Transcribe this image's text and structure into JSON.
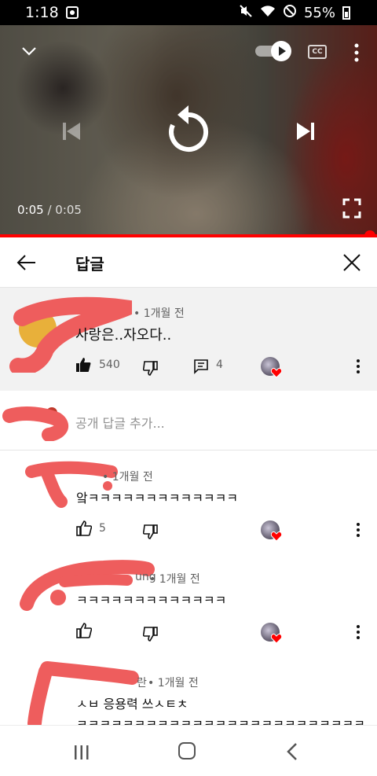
{
  "status_bar": {
    "time": "1:18",
    "battery": "55%"
  },
  "video": {
    "current_time": "0:05",
    "separator": " / ",
    "duration": "0:05",
    "cc_label": "CC"
  },
  "header": {
    "title": "답글"
  },
  "original_comment": {
    "age": "• 1개월 전",
    "text": "사랑은..자오다..",
    "likes": "540",
    "replies": "4"
  },
  "add_reply": {
    "placeholder": "공개 답글 추가..."
  },
  "replies": [
    {
      "age": "• 1개월 전",
      "text": "앜ㅋㅋㅋㅋㅋㅋㅋㅋㅋㅋㅋㅋㅋ",
      "likes": "5"
    },
    {
      "author_fragment": "ung",
      "age": "• 1개월 전",
      "text": "ㅋㅋㅋㅋㅋㅋㅋㅋㅋㅋㅋㅋㅋ",
      "likes": ""
    },
    {
      "author_fragment": "란",
      "age": "• 1개월 전",
      "text": "ㅅㅂ 응용력 쓰ㅅㅌㅊ",
      "text2": "ㅋㅋㅋㅋㅋㅋㅋㅋㅋㅋㅋㅋㅋㅋㅋㅋㅋㅋㅋㅋㅋㅋㅋㅋㅋ"
    }
  ],
  "colors": {
    "accent": "#ff0000",
    "redaction": "#ee5d5d",
    "heart": "#ff0000"
  },
  "icons": [
    "chevron-down-icon",
    "autoplay-toggle",
    "cc-icon",
    "more-vertical-icon",
    "previous-icon",
    "replay-icon",
    "next-icon",
    "fullscreen-icon",
    "back-arrow-icon",
    "close-icon",
    "thumb-up-icon",
    "thumb-down-icon",
    "reply-icon",
    "heart-icon"
  ]
}
